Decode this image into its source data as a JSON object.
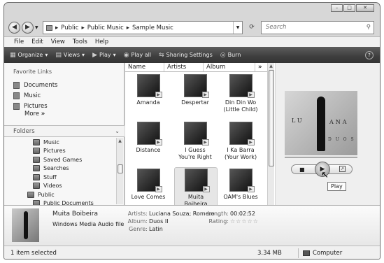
{
  "address": {
    "crumbs": [
      "Public",
      "Public Music",
      "Sample Music"
    ],
    "search_placeholder": "Search"
  },
  "menu": [
    "File",
    "Edit",
    "View",
    "Tools",
    "Help"
  ],
  "toolbar": {
    "organize": "Organize",
    "views": "Views",
    "play": "Play",
    "play_all": "Play all",
    "sharing": "Sharing Settings",
    "burn": "Burn"
  },
  "nav": {
    "favorites_title": "Favorite Links",
    "favorites": [
      "Documents",
      "Music",
      "Pictures"
    ],
    "more": "More",
    "folders_title": "Folders",
    "tree": [
      "Music",
      "Pictures",
      "Saved Games",
      "Searches",
      "Stuff",
      "Videos",
      "Public",
      "Public Documents"
    ]
  },
  "columns": [
    "Name",
    "Artists",
    "Album"
  ],
  "tiles": [
    {
      "name": "Amanda",
      "name2": ""
    },
    {
      "name": "Despertar",
      "name2": ""
    },
    {
      "name": "Din Din Wo",
      "name2": "(Little Child)"
    },
    {
      "name": "Distance",
      "name2": ""
    },
    {
      "name": "I Guess",
      "name2": "You're Right"
    },
    {
      "name": "I Ka Barra",
      "name2": "(Your Work)"
    },
    {
      "name": "Love Comes",
      "name2": ""
    },
    {
      "name": "Muita",
      "name2": "Boibeira"
    },
    {
      "name": "OAM's Blues",
      "name2": ""
    }
  ],
  "preview": {
    "art_left": "LU",
    "art_right": "ANA",
    "art_bottom": "D U O S",
    "tooltip": "Play"
  },
  "details": {
    "title": "Muita Boibeira",
    "type": "Windows Media Audio file",
    "artists_label": "Artists:",
    "artists": "Luciana Souza; Romero ...",
    "album_label": "Album:",
    "album": "Duos II",
    "genre_label": "Genre:",
    "genre": "Latin",
    "length_label": "Length:",
    "length": "00:02:52",
    "rating_label": "Rating:",
    "rating_stars": "☆☆☆☆☆"
  },
  "status": {
    "selected": "1 item selected",
    "size": "3.34 MB",
    "location": "Computer"
  }
}
